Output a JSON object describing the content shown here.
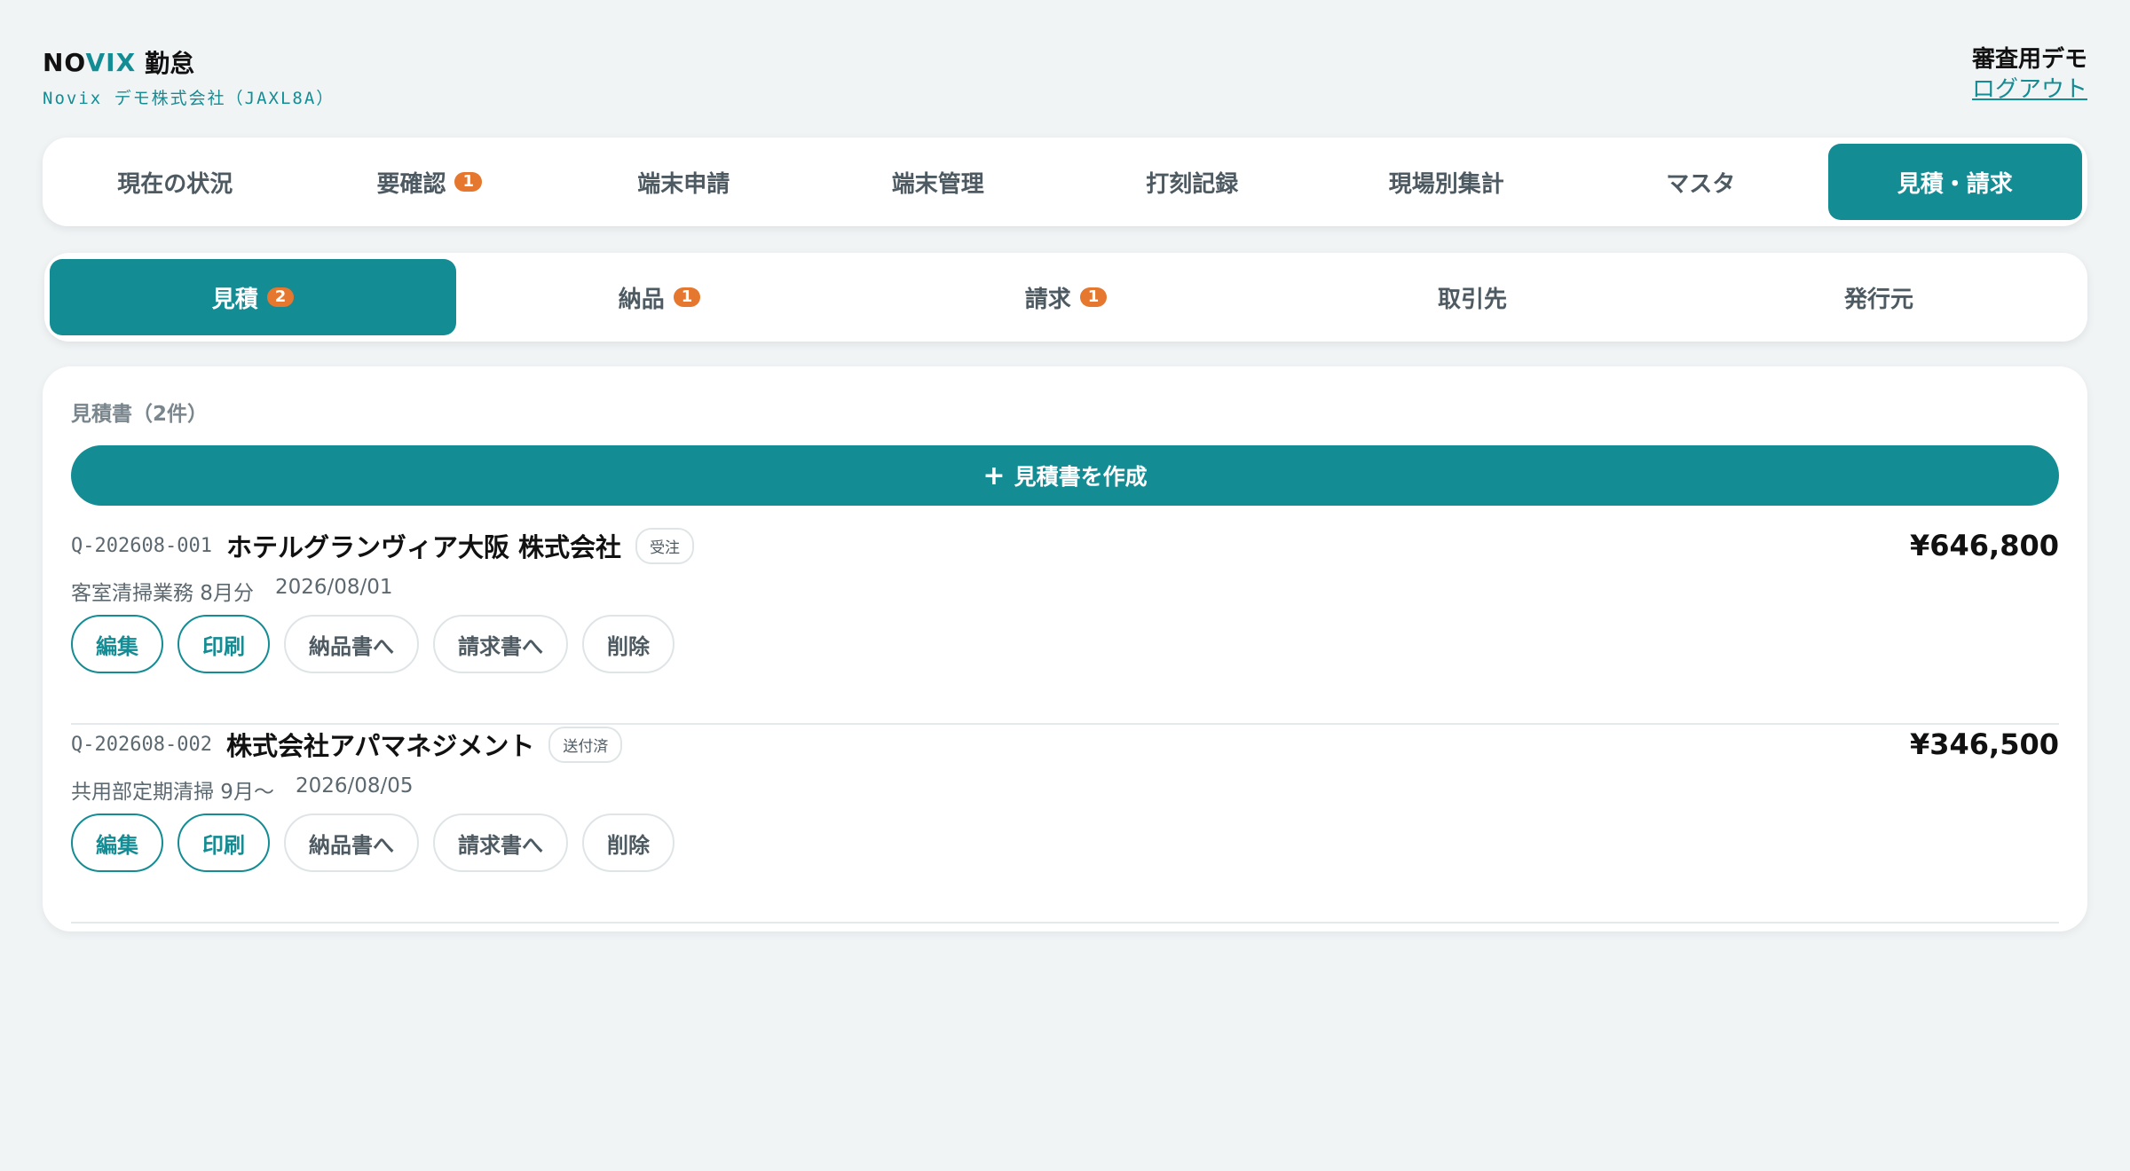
{
  "header": {
    "brand_part1": "NO",
    "brand_part2": "VIX",
    "brand_sub": "勤怠",
    "company": "Novix デモ株式会社（JAXL8A）",
    "user_name": "審査用デモ",
    "logout_label": "ログアウト"
  },
  "main_nav": {
    "tabs": [
      {
        "label": "現在の状況"
      },
      {
        "label": "要確認",
        "badge": "1"
      },
      {
        "label": "端末申請"
      },
      {
        "label": "端末管理"
      },
      {
        "label": "打刻記録"
      },
      {
        "label": "現場別集計"
      },
      {
        "label": "マスタ"
      },
      {
        "label": "見積・請求"
      }
    ],
    "active": "見積・請求"
  },
  "sub_nav": {
    "tabs": [
      {
        "label": "見積",
        "badge": "2"
      },
      {
        "label": "納品",
        "badge": "1"
      },
      {
        "label": "請求",
        "badge": "1"
      },
      {
        "label": "取引先"
      },
      {
        "label": "発行元"
      }
    ],
    "active": "見積"
  },
  "panel": {
    "title": "見積書（2件）",
    "create_icon": "plus-icon",
    "create_label": "見積書を作成"
  },
  "quotes": [
    {
      "id": "Q-202608-001",
      "client": "ホテルグランヴィア大阪 株式会社",
      "status": "受注",
      "amount": "¥646,800",
      "description": "客室清掃業務 8月分",
      "date": "2026/08/01"
    },
    {
      "id": "Q-202608-002",
      "client": "株式会社アパマネジメント",
      "status": "送付済",
      "amount": "¥346,500",
      "description": "共用部定期清掃 9月〜",
      "date": "2026/08/05"
    }
  ],
  "actions": {
    "edit": "編集",
    "print": "印刷",
    "to_delivery": "納品書へ",
    "to_invoice": "請求書へ",
    "delete": "削除"
  },
  "colors": {
    "accent": "#148c94",
    "badge": "#e5772e",
    "background": "#f0f4f5"
  }
}
